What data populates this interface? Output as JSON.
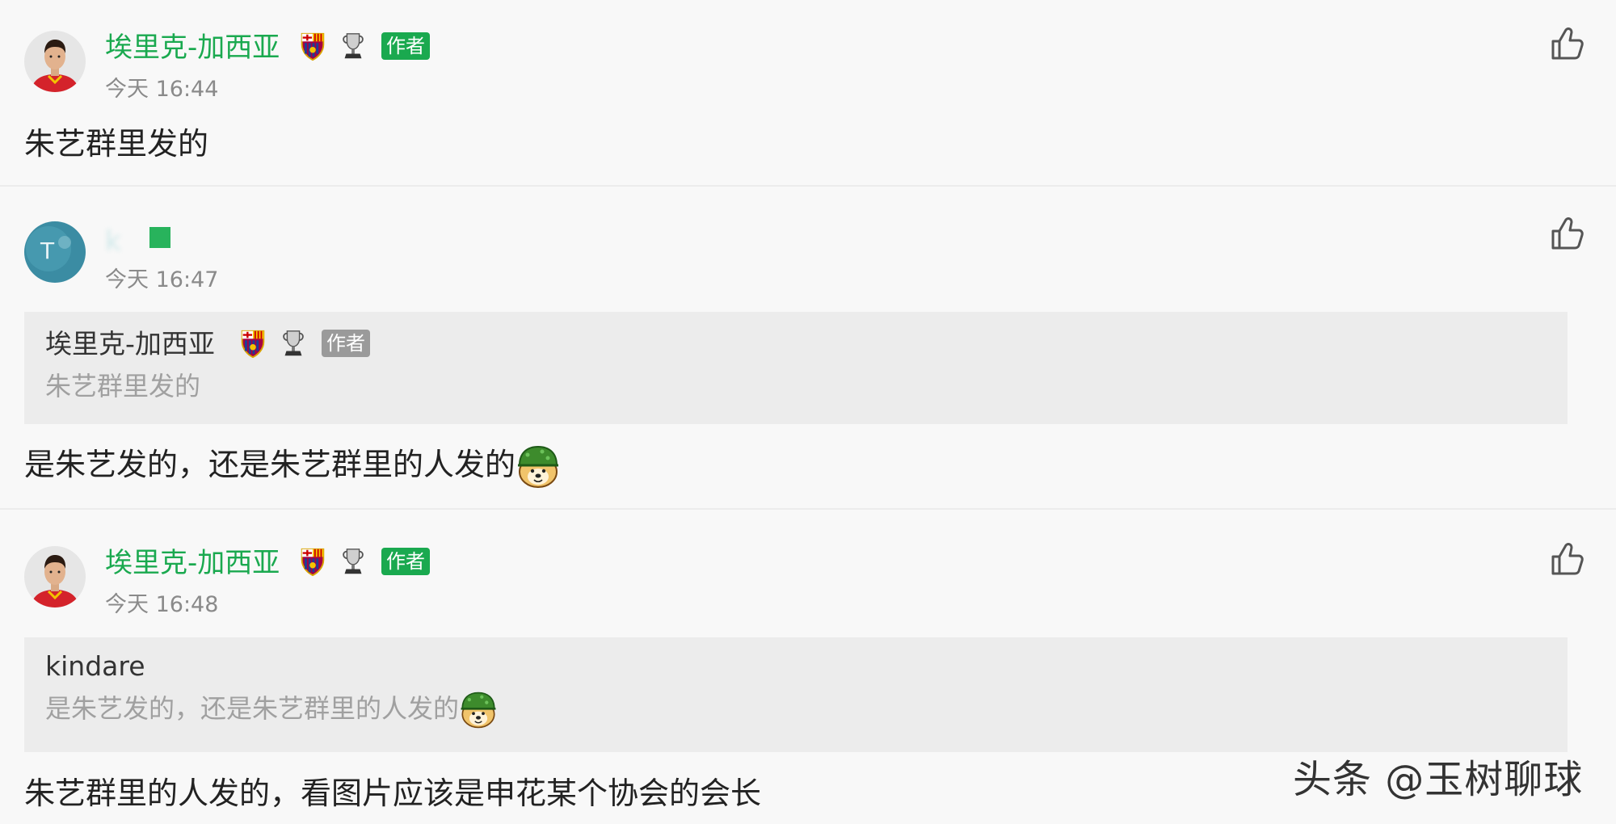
{
  "comments": [
    {
      "author": "埃里克-加西亚",
      "author_tag": "作者",
      "time": "今天 16:44",
      "text": "朱艺群里发的"
    },
    {
      "author": "k",
      "time": "今天 16:47",
      "quote": {
        "author": "埃里克-加西亚",
        "author_tag": "作者",
        "text": "朱艺群里发的"
      },
      "text": "是朱艺发的，还是朱艺群里的人发的"
    },
    {
      "author": "埃里克-加西亚",
      "author_tag": "作者",
      "time": "今天 16:48",
      "quote": {
        "author": "kindare",
        "text": "是朱艺发的，还是朱艺群里的人发的"
      },
      "text": "朱艺群里的人发的，看图片应该是申花某个协会的会长"
    }
  ],
  "watermark": "头条 @玉树聊球",
  "colors": {
    "author_name": "#1aa94f",
    "author_tag_bg": "#1aa94f",
    "quote_tag_bg": "#9a9a9a",
    "background": "#f8f8f8",
    "quote_bg": "#ececec"
  },
  "icons": [
    "avatar-player",
    "avatar-teal",
    "barcelona-crest-icon",
    "trophy-icon",
    "thumbs-up-icon",
    "helmet-doge-emoji"
  ]
}
